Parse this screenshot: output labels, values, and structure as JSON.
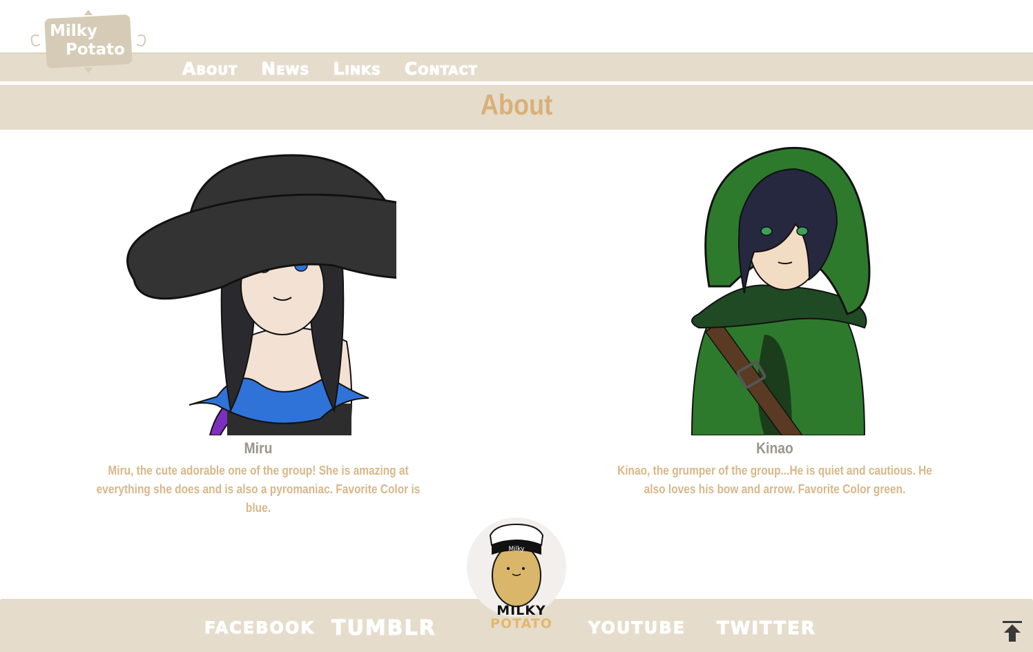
{
  "logo": {
    "line1": "Milky",
    "line2": "Potato"
  },
  "nav": {
    "items": [
      "About",
      "News",
      "Links",
      "Contact"
    ]
  },
  "page": {
    "title": "About"
  },
  "characters": [
    {
      "name": "Miru",
      "description": "Miru, the cute adorable one of the group! She is amazing at everything she does and is also a pyromaniac. Favorite Color is blue."
    },
    {
      "name": "Kinao",
      "description": "Kinao, the grumper of the group...He is quiet and cautious. He also loves his bow and arrow. Favorite Color green."
    }
  ],
  "footer": {
    "links": [
      "facebook",
      "tumblr",
      "youtube",
      "twitter"
    ],
    "mascot": {
      "line1": "MILKY",
      "line2": "POTATO",
      "hat_text": "Milky"
    },
    "back_to_top_icon": "arrow-up-to-top-icon"
  },
  "colors": {
    "band": "#e5dccb",
    "title": "#d9b07a",
    "name": "#9b948a",
    "description": "#d8b789"
  }
}
